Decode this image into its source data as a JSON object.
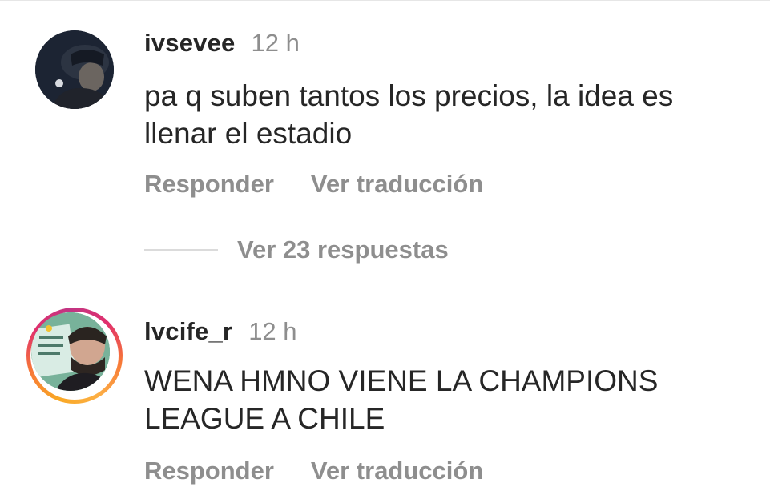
{
  "comments": [
    {
      "username": "ivsevee",
      "time": "12 h",
      "text": "pa q suben tantos los precios, la idea es\nllenar el estadio",
      "reply_label": "Responder",
      "translate_label": "Ver traducción",
      "view_replies_label": "Ver 23 respuestas",
      "has_story_ring": false
    },
    {
      "username": "lvcife_r",
      "time": "12 h",
      "text": "WENA HMNO VIENE LA CHAMPIONS\nLEAGUE A CHILE",
      "reply_label": "Responder",
      "translate_label": "Ver traducción",
      "has_story_ring": true
    }
  ],
  "colors": {
    "text_primary": "#262626",
    "text_secondary": "#8e8e8e",
    "divider": "#dbdbdb",
    "story_ring": [
      "#f9a825",
      "#f77737",
      "#e1306c",
      "#c13584"
    ]
  }
}
